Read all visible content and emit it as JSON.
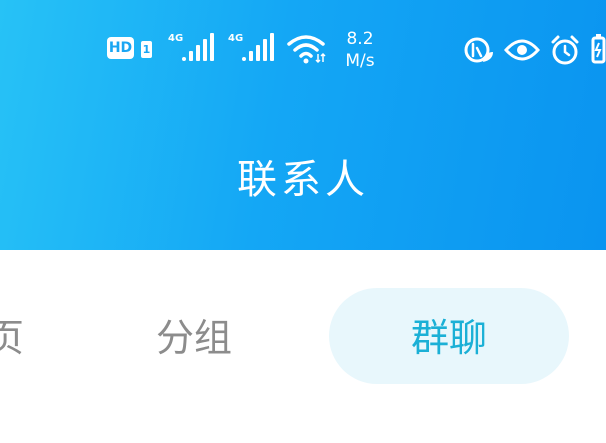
{
  "status_bar": {
    "hd_label": "HD",
    "sim_label": "1",
    "network_1": "4G",
    "network_2": "4G",
    "speed_value": "8.2",
    "speed_unit": "M/s",
    "icons": [
      "hd-voice-icon",
      "signal-icon",
      "signal-icon",
      "wifi-icon",
      "eco-leaf-icon",
      "eye-comfort-icon",
      "alarm-icon",
      "battery-icon"
    ]
  },
  "header": {
    "title": "联系人",
    "background_colors": [
      "#27c2f6",
      "#0a94f0"
    ]
  },
  "tabs": [
    {
      "label": "页",
      "partial": true
    },
    {
      "label": "分组",
      "active": false
    },
    {
      "label": "群聊",
      "active": true
    }
  ],
  "colors": {
    "tab_active_text": "#1bb0d6",
    "tab_active_bg": "#e8f7fc",
    "tab_inactive_text": "#8c8c8c"
  }
}
